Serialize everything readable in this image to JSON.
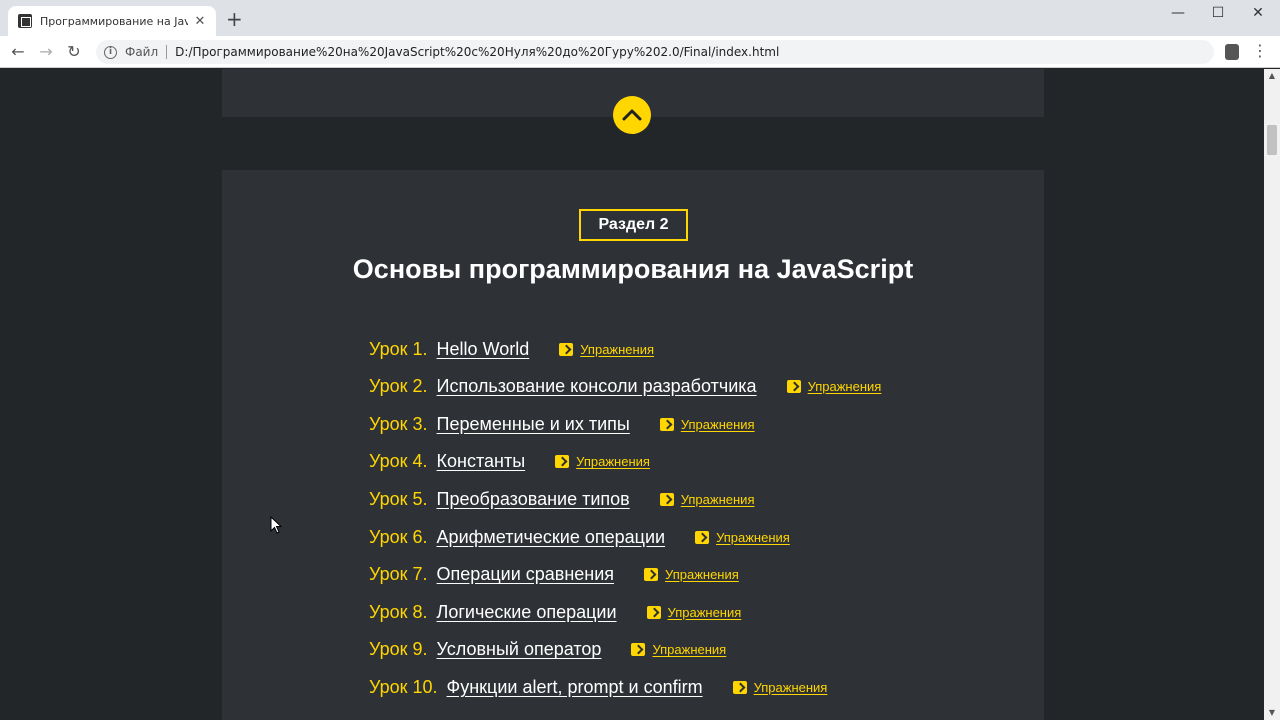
{
  "browser": {
    "tab_title": "Программирование на JavaScript",
    "tab_close": "✕",
    "new_tab": "+",
    "window_controls": {
      "minimize": "—",
      "maximize": "☐",
      "close": "✕"
    },
    "nav": {
      "back": "←",
      "forward": "→",
      "reload": "↻"
    },
    "scheme_label": "Файл",
    "url": "D:/Программирование%20на%20JavaScript%20с%20Нуля%20до%20Гуру%202.0/Final/index.html",
    "menu": "⋮"
  },
  "section": {
    "badge": "Раздел 2",
    "title": "Основы программирования на JavaScript",
    "exercise_label": "Упражнения",
    "lessons": [
      {
        "num": "Урок 1.",
        "title": "Hello World"
      },
      {
        "num": "Урок 2.",
        "title": "Использование консоли разработчика"
      },
      {
        "num": "Урок 3.",
        "title": "Переменные и их типы"
      },
      {
        "num": "Урок 4.",
        "title": "Константы"
      },
      {
        "num": "Урок 5.",
        "title": "Преобразование типов"
      },
      {
        "num": "Урок 6.",
        "title": "Арифметические операции"
      },
      {
        "num": "Урок 7.",
        "title": "Операции сравнения"
      },
      {
        "num": "Урок 8.",
        "title": "Логические операции"
      },
      {
        "num": "Урок 9.",
        "title": "Условный оператор"
      },
      {
        "num": "Урок 10.",
        "title": "Функции alert, prompt и confirm"
      }
    ]
  },
  "colors": {
    "accent": "#ffd600",
    "card_bg": "#2e3136",
    "page_bg": "#232629"
  }
}
